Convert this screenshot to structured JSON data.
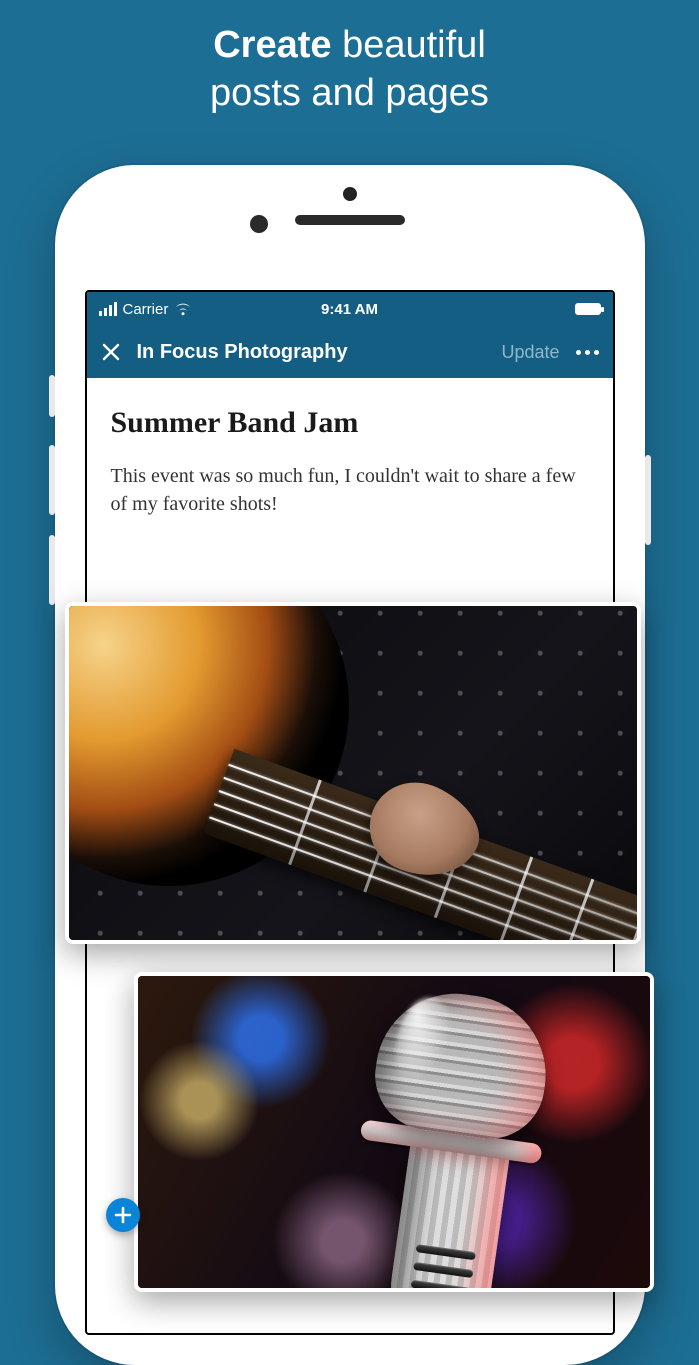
{
  "promo": {
    "strong": "Create",
    "rest_line1": " beautiful",
    "line2": "posts and pages"
  },
  "statusbar": {
    "carrier": "Carrier",
    "time": "9:41 AM"
  },
  "navbar": {
    "title": "In Focus Photography",
    "update": "Update"
  },
  "post": {
    "title": "Summer Band Jam",
    "body": "This event was so much fun, I couldn't wait to share a few of my favorite shots!"
  },
  "icons": {
    "close": "close-icon",
    "more": "more-icon",
    "wifi": "wifi-icon",
    "signal": "signal-icon",
    "battery": "battery-icon",
    "add": "add-icon"
  }
}
